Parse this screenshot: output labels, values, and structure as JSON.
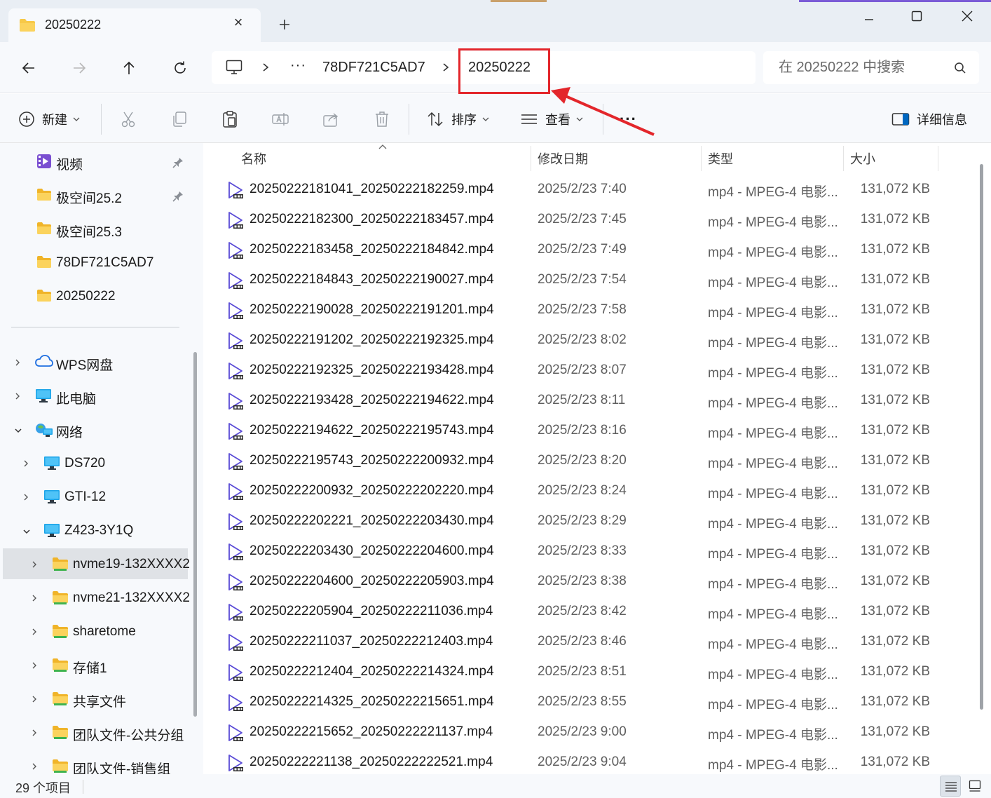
{
  "window": {
    "tab_title": "20250222",
    "close_tab_glyph": "×",
    "new_tab_glyph": "+",
    "controls": [
      "minimize",
      "maximize",
      "close"
    ]
  },
  "address": {
    "breadcrumbs": [
      "此电脑",
      "…",
      "78DF721C5AD7",
      "20250222"
    ],
    "ellipsis": "···",
    "parent": "78DF721C5AD7",
    "current": "20250222",
    "search_placeholder": "在 20250222 中搜索"
  },
  "toolbar": {
    "new_label": "新建",
    "sort_label": "排序",
    "view_label": "查看",
    "more_label": "···",
    "details_label": "详细信息"
  },
  "sidebar": {
    "quick_access": [
      {
        "label": "视频",
        "icon": "video-folder-icon",
        "pinned": true
      },
      {
        "label": "极空间25.2",
        "icon": "folder-icon",
        "pinned": true
      },
      {
        "label": "极空间25.3",
        "icon": "folder-icon",
        "pinned": false
      },
      {
        "label": "78DF721C5AD7",
        "icon": "folder-icon",
        "pinned": false
      },
      {
        "label": "20250222",
        "icon": "folder-icon",
        "pinned": false
      }
    ],
    "tree": [
      {
        "label": "WPS网盘",
        "icon": "cloud-icon",
        "expanded": false
      },
      {
        "label": "此电脑",
        "icon": "computer-icon",
        "expanded": false
      },
      {
        "label": "网络",
        "icon": "network-icon",
        "expanded": true
      },
      {
        "label": "DS720",
        "icon": "computer-icon",
        "expanded": false
      },
      {
        "label": "GTI-12",
        "icon": "computer-icon",
        "expanded": false
      },
      {
        "label": "Z423-3Y1Q",
        "icon": "computer-icon",
        "expanded": true
      },
      {
        "label": "nvme19-132XXXX2",
        "icon": "share-folder-icon",
        "expanded": false,
        "selected": true
      },
      {
        "label": "nvme21-132XXXX2",
        "icon": "share-folder-icon",
        "expanded": false
      },
      {
        "label": "sharetome",
        "icon": "share-folder-icon",
        "expanded": false
      },
      {
        "label": "存储1",
        "icon": "share-folder-icon",
        "expanded": false
      },
      {
        "label": "共享文件",
        "icon": "share-folder-icon",
        "expanded": false
      },
      {
        "label": "团队文件-公共分组",
        "icon": "share-folder-icon",
        "expanded": false
      },
      {
        "label": "团队文件-销售组",
        "icon": "share-folder-icon",
        "expanded": false
      }
    ]
  },
  "columns": {
    "name": "名称",
    "date": "修改日期",
    "type": "类型",
    "size": "大小"
  },
  "files": [
    {
      "name": "20250222181041_20250222182259.mp4",
      "date": "2025/2/23 7:40",
      "type": "mp4 - MPEG-4 电影...",
      "size": "131,072 KB"
    },
    {
      "name": "20250222182300_20250222183457.mp4",
      "date": "2025/2/23 7:45",
      "type": "mp4 - MPEG-4 电影...",
      "size": "131,072 KB"
    },
    {
      "name": "20250222183458_20250222184842.mp4",
      "date": "2025/2/23 7:49",
      "type": "mp4 - MPEG-4 电影...",
      "size": "131,072 KB"
    },
    {
      "name": "20250222184843_20250222190027.mp4",
      "date": "2025/2/23 7:54",
      "type": "mp4 - MPEG-4 电影...",
      "size": "131,072 KB"
    },
    {
      "name": "20250222190028_20250222191201.mp4",
      "date": "2025/2/23 7:58",
      "type": "mp4 - MPEG-4 电影...",
      "size": "131,072 KB"
    },
    {
      "name": "20250222191202_20250222192325.mp4",
      "date": "2025/2/23 8:02",
      "type": "mp4 - MPEG-4 电影...",
      "size": "131,072 KB"
    },
    {
      "name": "20250222192325_20250222193428.mp4",
      "date": "2025/2/23 8:07",
      "type": "mp4 - MPEG-4 电影...",
      "size": "131,072 KB"
    },
    {
      "name": "20250222193428_20250222194622.mp4",
      "date": "2025/2/23 8:11",
      "type": "mp4 - MPEG-4 电影...",
      "size": "131,072 KB"
    },
    {
      "name": "20250222194622_20250222195743.mp4",
      "date": "2025/2/23 8:16",
      "type": "mp4 - MPEG-4 电影...",
      "size": "131,072 KB"
    },
    {
      "name": "20250222195743_20250222200932.mp4",
      "date": "2025/2/23 8:20",
      "type": "mp4 - MPEG-4 电影...",
      "size": "131,072 KB"
    },
    {
      "name": "20250222200932_20250222202220.mp4",
      "date": "2025/2/23 8:24",
      "type": "mp4 - MPEG-4 电影...",
      "size": "131,072 KB"
    },
    {
      "name": "20250222202221_20250222203430.mp4",
      "date": "2025/2/23 8:29",
      "type": "mp4 - MPEG-4 电影...",
      "size": "131,072 KB"
    },
    {
      "name": "20250222203430_20250222204600.mp4",
      "date": "2025/2/23 8:33",
      "type": "mp4 - MPEG-4 电影...",
      "size": "131,072 KB"
    },
    {
      "name": "20250222204600_20250222205903.mp4",
      "date": "2025/2/23 8:38",
      "type": "mp4 - MPEG-4 电影...",
      "size": "131,072 KB"
    },
    {
      "name": "20250222205904_20250222211036.mp4",
      "date": "2025/2/23 8:42",
      "type": "mp4 - MPEG-4 电影...",
      "size": "131,072 KB"
    },
    {
      "name": "20250222211037_20250222212403.mp4",
      "date": "2025/2/23 8:46",
      "type": "mp4 - MPEG-4 电影...",
      "size": "131,072 KB"
    },
    {
      "name": "20250222212404_20250222214324.mp4",
      "date": "2025/2/23 8:51",
      "type": "mp4 - MPEG-4 电影...",
      "size": "131,072 KB"
    },
    {
      "name": "20250222214325_20250222215651.mp4",
      "date": "2025/2/23 8:55",
      "type": "mp4 - MPEG-4 电影...",
      "size": "131,072 KB"
    },
    {
      "name": "20250222215652_20250222221137.mp4",
      "date": "2025/2/23 9:00",
      "type": "mp4 - MPEG-4 电影...",
      "size": "131,072 KB"
    },
    {
      "name": "20250222221138_20250222222521.mp4",
      "date": "2025/2/23 9:04",
      "type": "mp4 - MPEG-4 电影...",
      "size": "131,072 KB"
    }
  ],
  "status": {
    "item_count": "29 个项目"
  },
  "colors": {
    "accent": "#0067c0",
    "folder": "#f7c948",
    "highlight": "#e3262b"
  }
}
